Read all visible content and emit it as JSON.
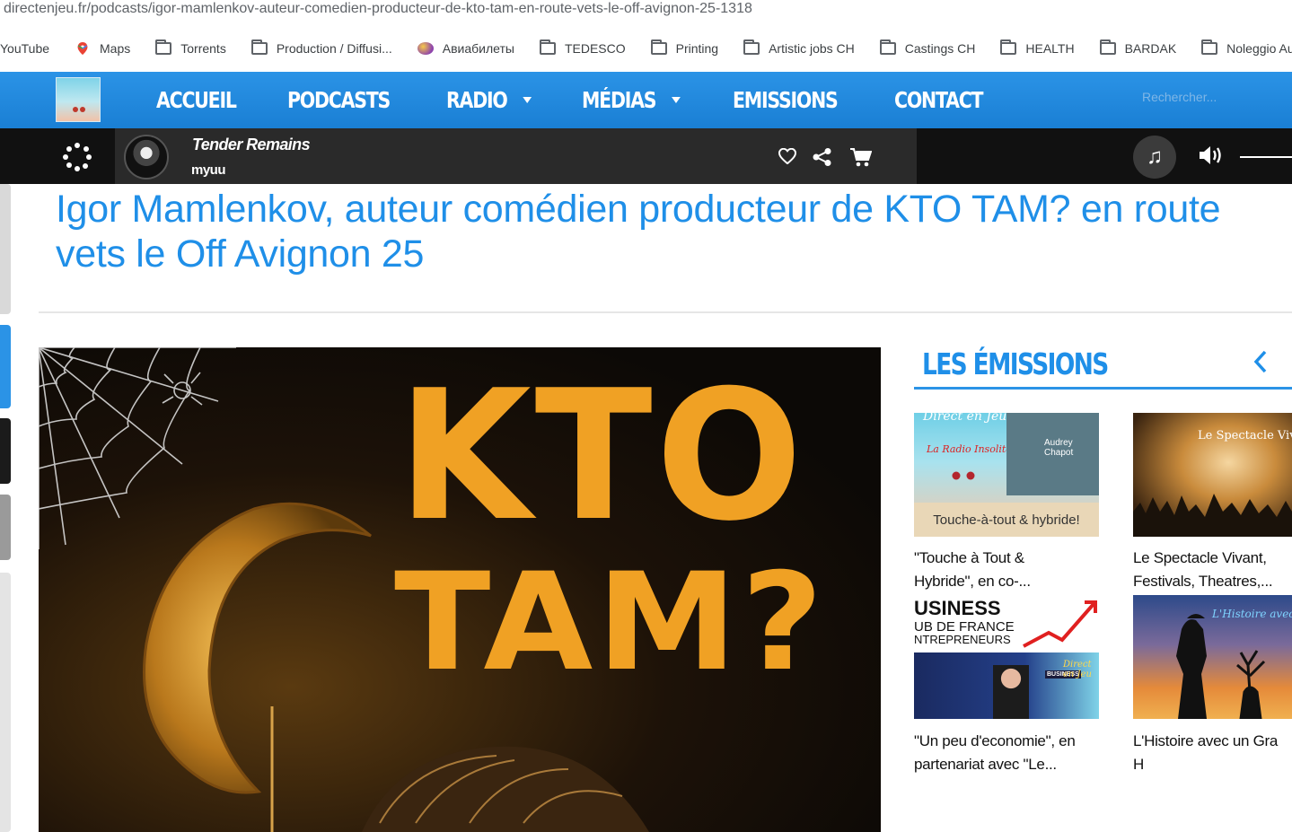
{
  "browser": {
    "url": "directenjeu.fr/podcasts/igor-mamlenkov-auteur-comedien-producteur-de-kto-tam-en-route-vets-le-off-avignon-25-1318",
    "bookmarks": [
      "YouTube",
      "Maps",
      "Torrents",
      "Production / Diffusi...",
      "Авиабилеты",
      "TEDESCO",
      "Printing",
      "Artistic jobs CH",
      "Castings CH",
      "HEALTH",
      "BARDAK",
      "Noleggio Auto"
    ]
  },
  "nav": {
    "items": [
      "ACCUEIL",
      "PODCASTS",
      "RADIO",
      "MÉDIAS",
      "EMISSIONS",
      "CONTACT"
    ],
    "search_placeholder": "Rechercher..."
  },
  "player": {
    "track_title": "Tender Remains",
    "artist": "myuu"
  },
  "article": {
    "title_line1": "Igor Mamlenkov, auteur comédien producteur de KTO TAM? en route",
    "title_line2": "vets le Off Avignon 25",
    "hero_line1": "KTO",
    "hero_line2": "TAM?"
  },
  "sidebar": {
    "title": "LES ÉMISSIONS",
    "cards": [
      {
        "caption_line1": "\"Touche à Tout &",
        "caption_line2": "Hybride\", en co-...",
        "img_text": "Touche-à-tout & hybride!",
        "img_brand": "Direct en Jeu",
        "img_sub": "La Radio Insolite",
        "img_name": "Audrey Chapot"
      },
      {
        "caption_line1": "Le Spectacle Vivant,",
        "caption_line2": "Festivals, Theatres,...",
        "img_text": "Le Spectacle Vivant"
      },
      {
        "caption_line1": "\"Un peu d'economie\", en",
        "caption_line2": "partenariat avec \"Le...",
        "img_text": "USINESS",
        "img_text2": "UB DE FRANCE",
        "img_text3": "NTREPRENEURS",
        "img_badge": "BUSINESS",
        "img_brand": "Direct en Jeu"
      },
      {
        "caption_line1": "L'Histoire avec un Gra",
        "caption_line2": "H",
        "img_text": "L'Histoire avec un"
      }
    ]
  },
  "colors": {
    "accent": "#1f8fe8",
    "nav": "#2b93e6",
    "hero_text": "#f0a124",
    "player_bg": "#111111"
  }
}
